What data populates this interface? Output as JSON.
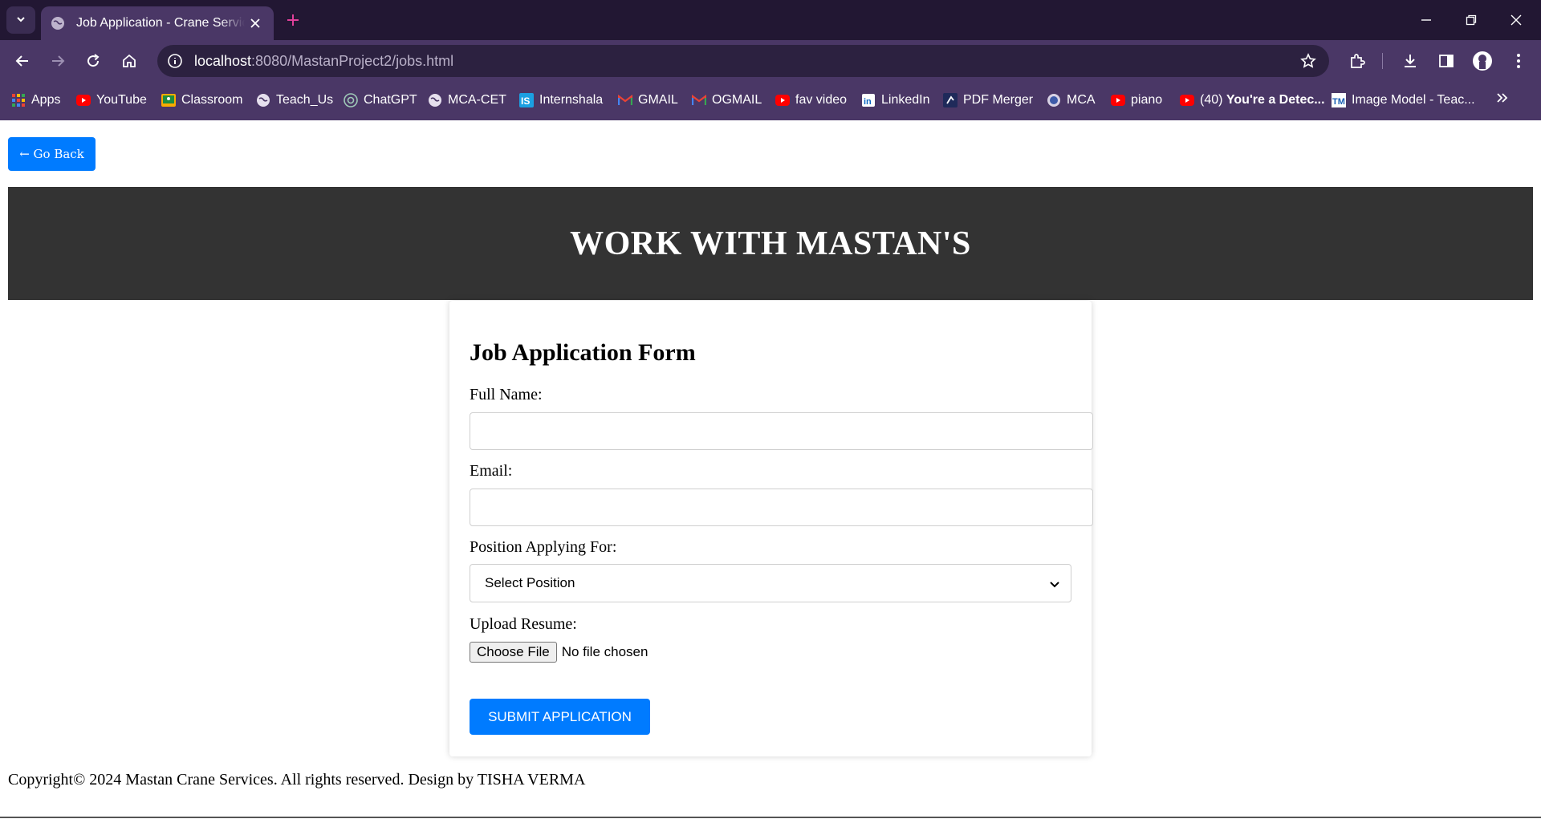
{
  "browser": {
    "tab_title": "Job Application - Crane Services",
    "url_host": "localhost",
    "url_rest": ":8080/MastanProject2/jobs.html",
    "bookmarks": [
      {
        "label": "Apps",
        "icon": "apps-grid-icon"
      },
      {
        "label": "YouTube",
        "icon": "youtube-icon"
      },
      {
        "label": "Classroom",
        "icon": "classroom-icon"
      },
      {
        "label": "Teach_Us",
        "icon": "globe-icon"
      },
      {
        "label": "ChatGPT",
        "icon": "chatgpt-icon"
      },
      {
        "label": "MCA-CET",
        "icon": "globe-icon"
      },
      {
        "label": "Internshala",
        "icon": "internshala-icon"
      },
      {
        "label": "GMAIL",
        "icon": "gmail-icon"
      },
      {
        "label": "OGMAIL",
        "icon": "gmail-icon"
      },
      {
        "label": "fav video",
        "icon": "youtube-icon"
      },
      {
        "label": "LinkedIn",
        "icon": "linkedin-icon"
      },
      {
        "label": "PDF Merger",
        "icon": "pdf-merger-icon"
      },
      {
        "label": "MCA",
        "icon": "cet-icon"
      },
      {
        "label": "piano",
        "icon": "youtube-icon"
      },
      {
        "label_prefix": "(40) ",
        "label_bold": "You're a Detec...",
        "icon": "youtube-icon"
      },
      {
        "label": "Image Model - Teac...",
        "icon": "tm-icon"
      }
    ],
    "colors": {
      "chrome_dark": "#221733",
      "chrome": "#4a3766",
      "omnibox": "#2c2140",
      "new_tab_plus": "#e0409a"
    }
  },
  "page": {
    "back_button": "← Go Back",
    "banner_title": "WORK WITH MASTAN'S",
    "form": {
      "heading": "Job Application Form",
      "full_name_label": "Full Name:",
      "full_name_value": "",
      "email_label": "Email:",
      "email_value": "",
      "position_label": "Position Applying For:",
      "position_selected": "Select Position",
      "resume_label": "Upload Resume:",
      "file_button": "Choose File",
      "file_status": "No file chosen",
      "submit": "SUBMIT APPLICATION"
    },
    "footer": "Copyright© 2024 Mastan Crane Services. All rights reserved. Design by TISHA VERMA",
    "colors": {
      "primary": "#007bff",
      "banner": "#333333"
    }
  }
}
